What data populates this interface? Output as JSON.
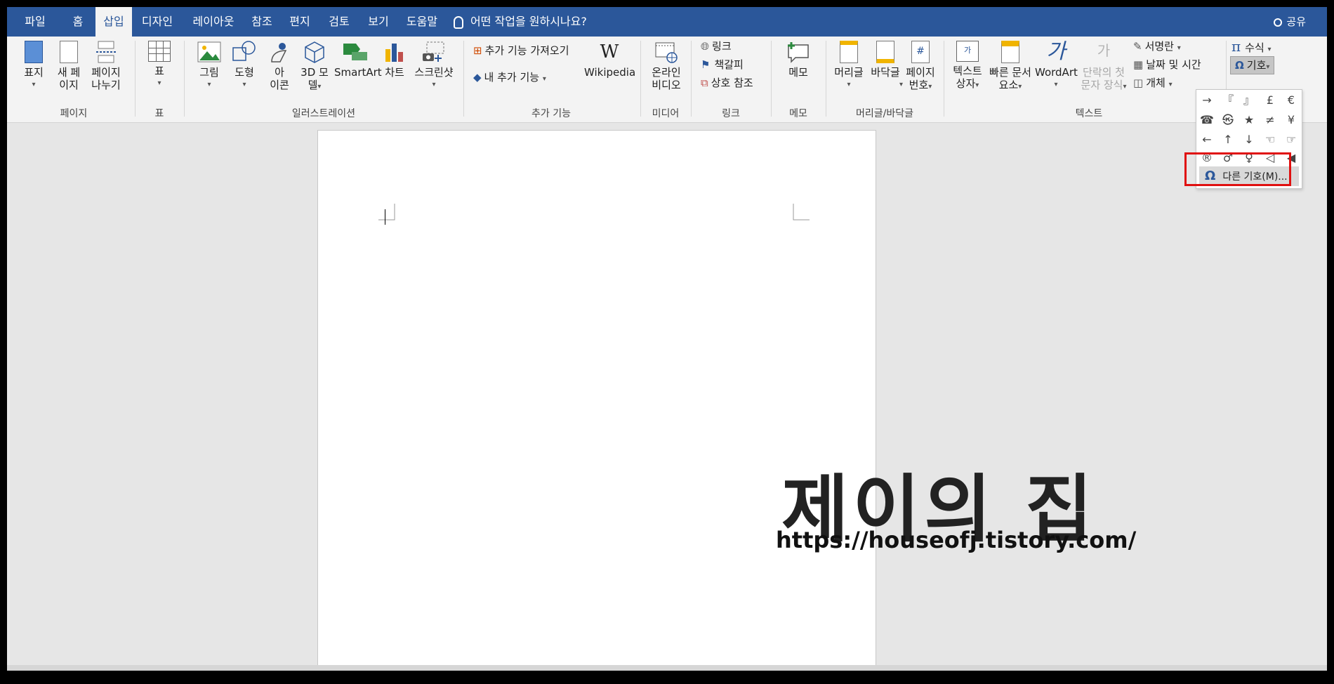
{
  "tabs": [
    {
      "label": "파일",
      "active": false
    },
    {
      "label": "홈",
      "active": false
    },
    {
      "label": "삽입",
      "active": true
    },
    {
      "label": "디자인",
      "active": false
    },
    {
      "label": "레이아웃",
      "active": false
    },
    {
      "label": "참조",
      "active": false
    },
    {
      "label": "편지",
      "active": false
    },
    {
      "label": "검토",
      "active": false
    },
    {
      "label": "보기",
      "active": false
    },
    {
      "label": "도움말",
      "active": false
    }
  ],
  "tell_me": "어떤 작업을 원하시나요?",
  "share_label": "공유",
  "ribbon": {
    "page_group": {
      "label": "페이지",
      "cover": "표지",
      "blank_page_1": "새 페",
      "blank_page_2": "이지",
      "page_break_1": "페이지",
      "page_break_2": "나누기"
    },
    "table_group": {
      "label": "표",
      "table": "표"
    },
    "illustrations": {
      "label": "일러스트레이션",
      "picture": "그림",
      "shapes": "도형",
      "icons_1": "아",
      "icons_2": "이콘",
      "model_1": "3D 모",
      "model_2": "델",
      "smartart": "SmartArt",
      "chart": "차트",
      "screenshot": "스크린샷"
    },
    "addins": {
      "label": "추가 기능",
      "get": "추가 기능 가져오기",
      "my": "내 추가 기능",
      "wikipedia": "Wikipedia"
    },
    "media": {
      "label": "미디어",
      "video_1": "온라인",
      "video_2": "비디오"
    },
    "links": {
      "label": "링크",
      "link": "링크",
      "bookmark": "책갈피",
      "crossref": "상호 참조"
    },
    "comments": {
      "label": "메모",
      "comment": "메모"
    },
    "header_footer": {
      "label": "머리글/바닥글",
      "header": "머리글",
      "footer": "바닥글",
      "pagenum_1": "페이지",
      "pagenum_2": "번호"
    },
    "text": {
      "label": "텍스트",
      "textbox_1": "텍스트",
      "textbox_2": "상자",
      "quickparts_1": "빠른 문서",
      "quickparts_2": "요소",
      "wordart": "WordArt",
      "dropcap_1": "단락의 첫",
      "dropcap_2": "문자 장식",
      "signature": "서명란",
      "datetime": "날짜 및 시간",
      "object": "개체"
    },
    "symbols": {
      "equation": "수식",
      "symbol": "기호"
    }
  },
  "symbol_dropdown": {
    "symbols": [
      "→",
      "『",
      "』",
      "£",
      "€",
      "☎",
      "㉿",
      "★",
      "≠",
      "¥",
      "←",
      "↑",
      "↓",
      "☜",
      "☞",
      "®",
      "♂",
      "♀",
      "◁",
      "◀"
    ],
    "more_symbols": "다른 기호(M)..."
  },
  "watermark": {
    "title": "제이의 집",
    "url": "https://houseofj.tistory.com/"
  },
  "colors": {
    "accent": "#2b579a",
    "highlight": "#e01010"
  }
}
